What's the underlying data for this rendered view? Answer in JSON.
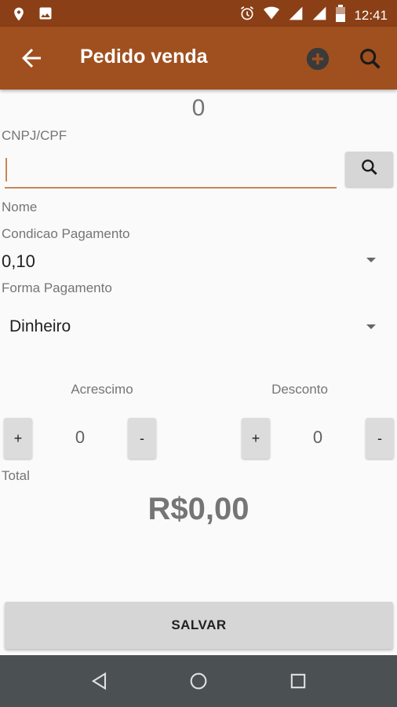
{
  "status_bar": {
    "time": "12:41",
    "icons": [
      "location-icon",
      "image-icon",
      "alarm-icon",
      "wifi-icon",
      "signal-icon",
      "signal-icon",
      "battery-icon"
    ]
  },
  "app_bar": {
    "title": "Pedido venda",
    "back_icon": "arrow-back-icon",
    "add_icon": "add-circle-icon",
    "search_icon": "search-icon",
    "color": "#a0501f",
    "status_color": "#8a3f16"
  },
  "form": {
    "counter": "0",
    "cnpj_label": "CNPJ/CPF",
    "cnpj_value": "",
    "nome_label": "Nome",
    "condicao_label": "Condicao Pagamento",
    "condicao_value": "0,10",
    "forma_label": "Forma Pagamento",
    "forma_value": "Dinheiro",
    "acrescimo_label": "Acrescimo",
    "acrescimo_value": "0",
    "desconto_label": "Desconto",
    "desconto_value": "0",
    "plus_label": "+",
    "minus_label": "-",
    "total_label": "Total",
    "total_value": "R$0,00",
    "save_label": "SALVAR"
  },
  "nav_bar": {
    "icons": [
      "back-nav-icon",
      "home-nav-icon",
      "recents-nav-icon"
    ]
  }
}
